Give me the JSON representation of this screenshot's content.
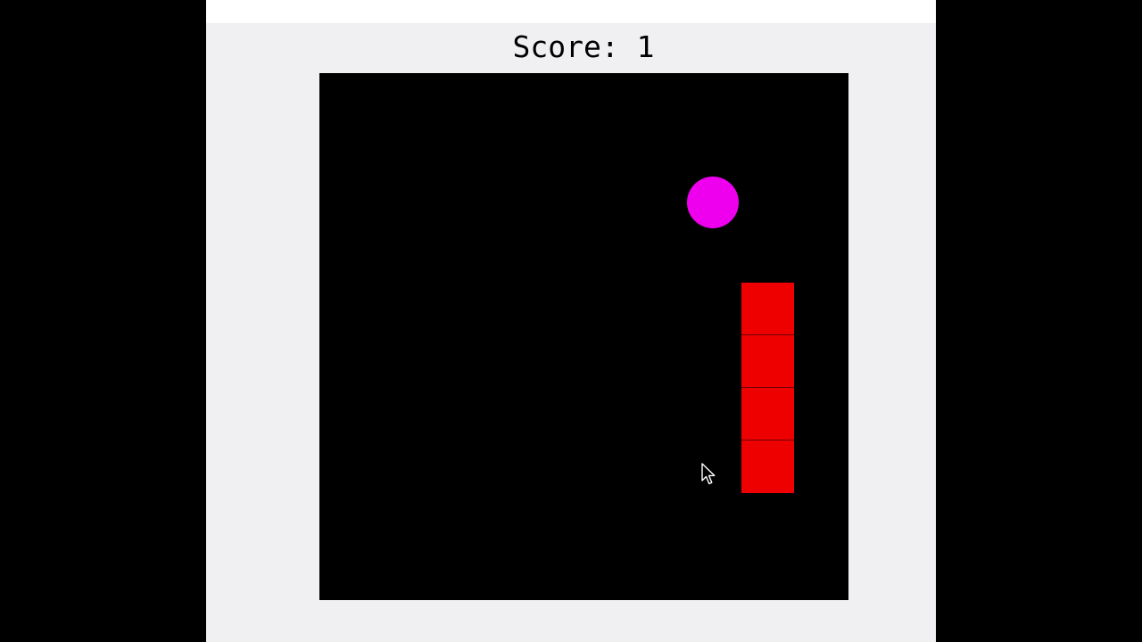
{
  "score": {
    "label": "Score:",
    "value": "1"
  },
  "colors": {
    "backdrop": "#000000",
    "window": "#f0eff1",
    "board": "#000000",
    "food": "#ee00ee",
    "snake": "#ee0000"
  },
  "food": {
    "col": 7,
    "row": 2
  },
  "snake": {
    "segments": [
      {
        "col": 8,
        "row": 4
      },
      {
        "col": 8,
        "row": 5
      },
      {
        "col": 8,
        "row": 6
      },
      {
        "col": 8,
        "row": 7
      }
    ]
  },
  "icons": {
    "cursor": "mouse-pointer-icon"
  }
}
